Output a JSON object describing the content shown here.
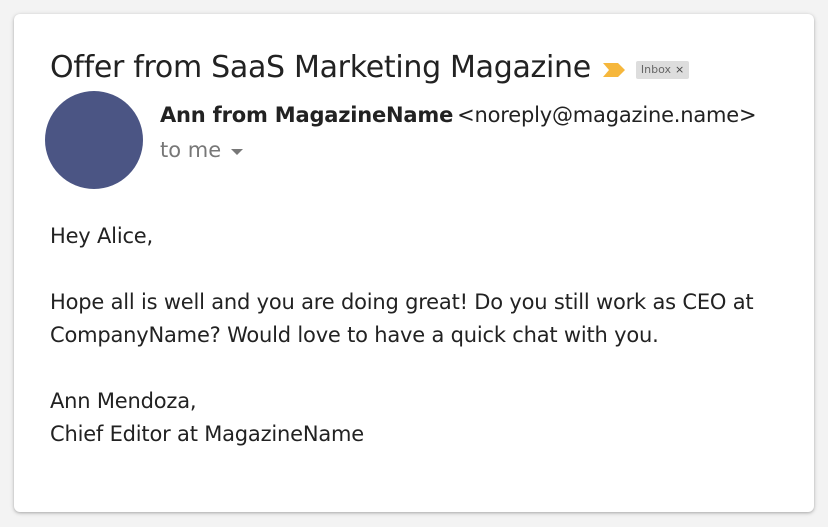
{
  "email": {
    "subject": "Offer from SaaS Marketing Magazine",
    "importance_icon": "importance-marker-icon",
    "label": {
      "text": "Inbox",
      "remove_glyph": "×"
    },
    "avatar": {
      "color": "#4b5584"
    },
    "sender": {
      "name": "Ann from MagazineName",
      "email": "<noreply@magazine.name>"
    },
    "recipient": "to me",
    "body": {
      "greeting": "Hey Alice,",
      "paragraph": "Hope all is well and you are doing great! Do you still work as CEO at CompanyName? Would love to have a quick chat with you.",
      "signature_name": "Ann Mendoza,",
      "signature_title": "Chief Editor at MagazineName"
    }
  },
  "colors": {
    "importance": "#f6b73c",
    "avatar": "#4b5584"
  }
}
